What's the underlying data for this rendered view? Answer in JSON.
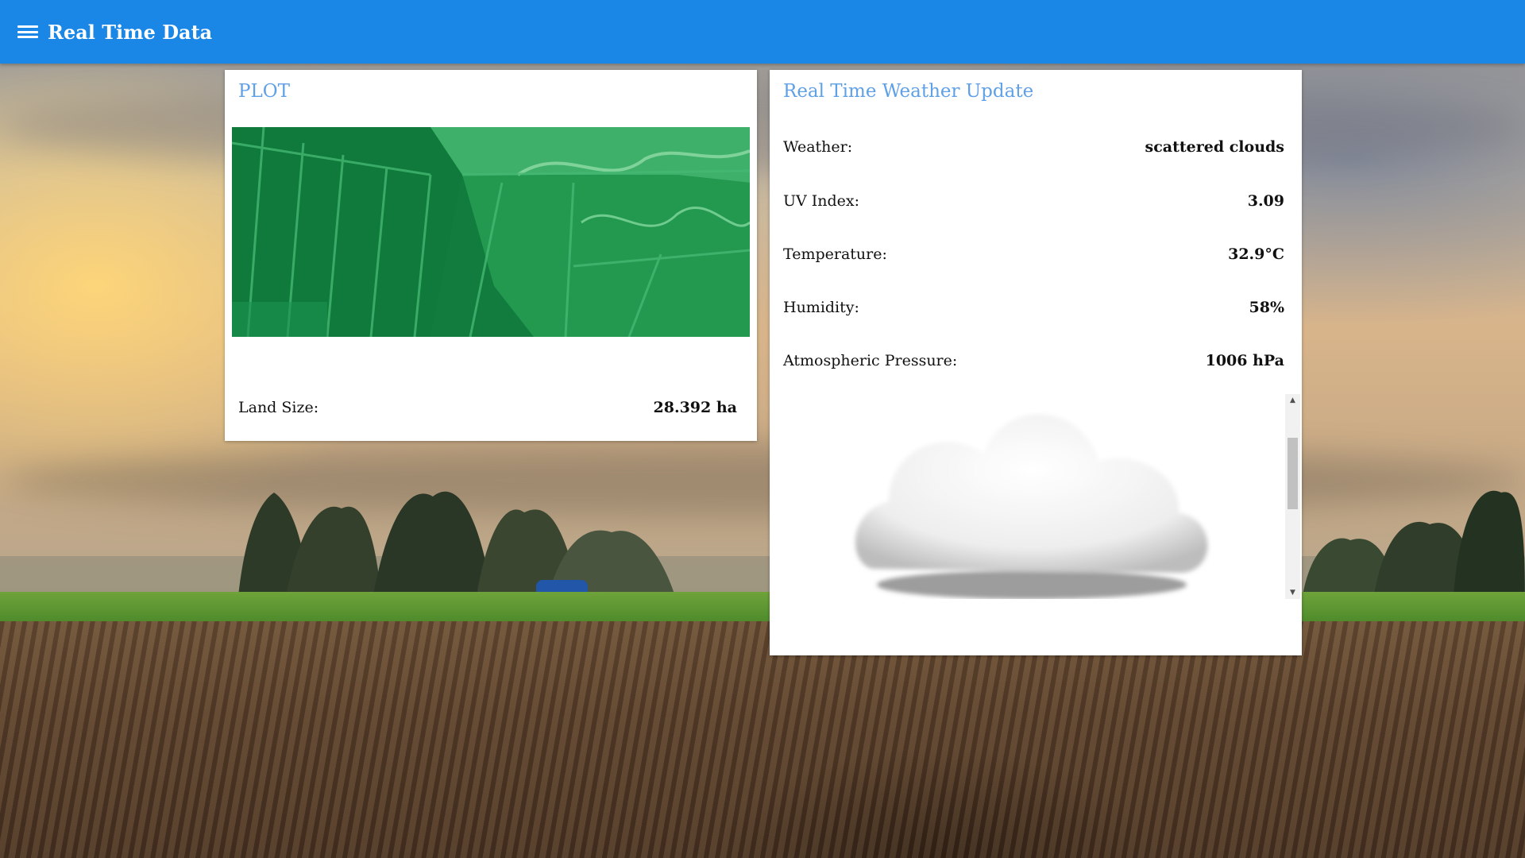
{
  "appbar": {
    "title": "Real Time Data",
    "menu_icon": "hamburger-menu-icon",
    "color": "#1a86e6"
  },
  "plot_card": {
    "title": "PLOT",
    "image_description_icon": "satellite-ndvi-plot-image",
    "land_size_label": "Land Size:",
    "land_size_value": "28.392 ha"
  },
  "weather_card": {
    "title": "Real Time Weather Update",
    "rows": [
      {
        "label": "Weather:",
        "value": "scattered clouds"
      },
      {
        "label": "UV Index:",
        "value": "3.09"
      },
      {
        "label": "Temperature:",
        "value": "32.9°C"
      },
      {
        "label": "Humidity:",
        "value": "58%"
      },
      {
        "label": "Atmospheric Pressure:",
        "value": "1006 hPa"
      }
    ],
    "weather_icon": "cloud-icon",
    "scroll_up_glyph": "▲",
    "scroll_down_glyph": "▼"
  },
  "colors": {
    "accent": "#1a86e6",
    "card_title": "#5fa0e6"
  }
}
